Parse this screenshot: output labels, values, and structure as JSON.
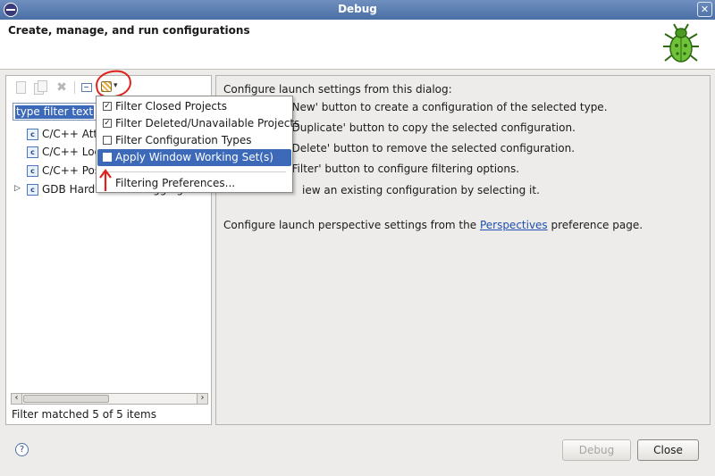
{
  "window": {
    "title": "Debug"
  },
  "header": {
    "title": "Create, manage, and run configurations"
  },
  "toolbar": {
    "new_icon": "new-config-icon",
    "duplicate_icon": "duplicate-config-icon",
    "delete_icon": "delete-config-icon",
    "collapse_icon": "collapse-all-icon",
    "filter_icon": "filter-menu-icon"
  },
  "filter": {
    "value": "type filter text"
  },
  "tree": {
    "items": [
      {
        "label": "C/C++ Attach to Application",
        "expandable": false
      },
      {
        "label": "C/C++ Local Application",
        "expandable": false
      },
      {
        "label": "C/C++ Postmortem Debugger",
        "expandable": false
      },
      {
        "label": "GDB Hardware Debugging",
        "expandable": true
      }
    ]
  },
  "status": {
    "text": "Filter matched 5 of 5 items"
  },
  "right_panel": {
    "line1": "Configure launch settings from this dialog:",
    "line2": "e 'New' button to create a configuration of the selected type.",
    "line3": "e 'Duplicate' button to copy the selected configuration.",
    "line4": "e 'Delete' button to remove the selected configuration.",
    "line5": "e 'Filter' button to configure filtering options.",
    "line6": "iew an existing configuration by selecting it.",
    "line7_prefix": "Configure launch perspective settings from the ",
    "line7_link": "Perspectives",
    "line7_suffix": " preference page."
  },
  "menu": {
    "items": [
      {
        "label": "Filter Closed Projects",
        "checked": true
      },
      {
        "label": "Filter Deleted/Unavailable Projects",
        "checked": true
      },
      {
        "label": "Filter Configuration Types",
        "checked": false
      },
      {
        "label": "Apply Window Working Set(s)",
        "checked": false,
        "highlighted": true
      }
    ],
    "preferences_label": "Filtering Preferences..."
  },
  "buttons": {
    "debug": "Debug",
    "close": "Close"
  },
  "colors": {
    "selection": "#3c69b8",
    "annotation": "#e0201c",
    "link": "#1f4fb0"
  }
}
